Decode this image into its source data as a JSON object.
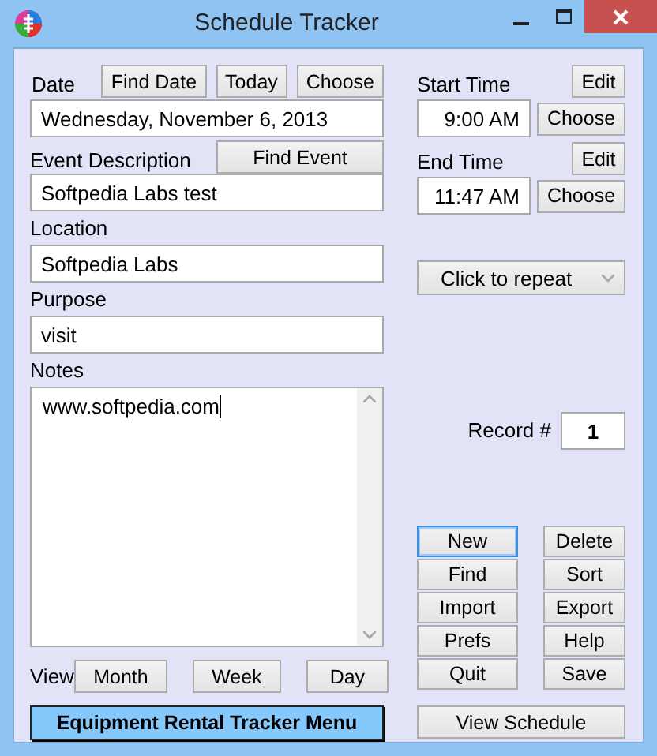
{
  "window": {
    "title": "Schedule Tracker"
  },
  "date": {
    "label": "Date",
    "buttons": [
      "Find Date",
      "Today",
      "Choose"
    ],
    "value": "Wednesday, November 6, 2013"
  },
  "event": {
    "label": "Event Description",
    "button": "Find Event",
    "value": "Softpedia Labs test"
  },
  "location": {
    "label": "Location",
    "value": "Softpedia Labs"
  },
  "purpose": {
    "label": "Purpose",
    "value": "visit"
  },
  "notes": {
    "label": "Notes",
    "value": "www.softpedia.com"
  },
  "view": {
    "label": "View",
    "buttons": [
      "Month",
      "Week",
      "Day"
    ]
  },
  "menu_button": "Equipment Rental Tracker Menu",
  "times": [
    {
      "label": "Start Time",
      "edit": "Edit",
      "value": "9:00 AM",
      "choose": "Choose"
    },
    {
      "label": "End Time",
      "edit": "Edit",
      "value": "11:47 AM",
      "choose": "Choose"
    }
  ],
  "repeat": {
    "value": "Click to repeat"
  },
  "record": {
    "label": "Record #",
    "value": "1"
  },
  "actions": [
    {
      "label": "New",
      "focused": true
    },
    {
      "label": "Delete",
      "focused": false
    },
    {
      "label": "Find",
      "focused": false
    },
    {
      "label": "Sort",
      "focused": false
    },
    {
      "label": "Import",
      "focused": false
    },
    {
      "label": "Export",
      "focused": false
    },
    {
      "label": "Prefs",
      "focused": false
    },
    {
      "label": "Help",
      "focused": false
    },
    {
      "label": "Quit",
      "focused": false
    },
    {
      "label": "Save",
      "focused": false
    }
  ],
  "view_schedule": "View Schedule"
}
